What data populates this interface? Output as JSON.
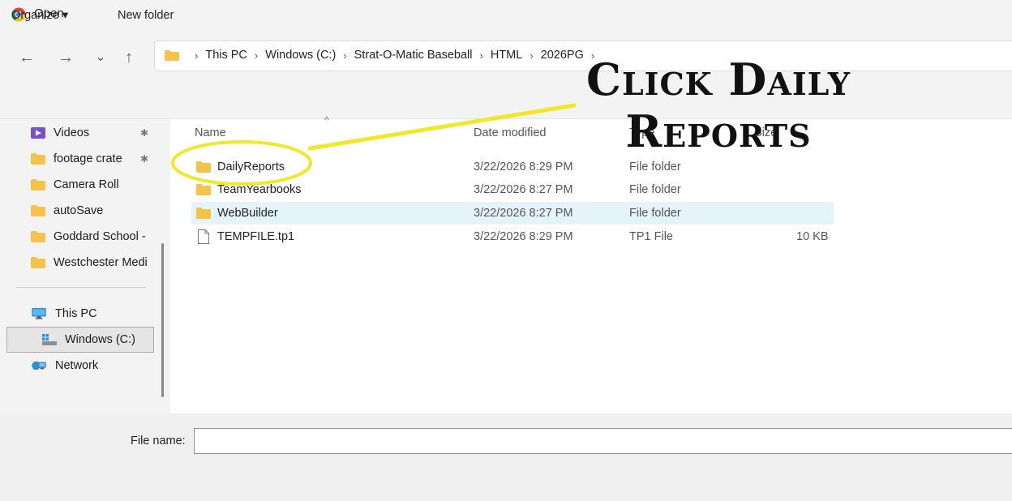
{
  "window": {
    "title": "Open",
    "app_icon": "chrome-icon"
  },
  "nav_buttons": {
    "back": "←",
    "forward": "→",
    "recent": "⌄",
    "up": "↑"
  },
  "breadcrumb": [
    "This PC",
    "Windows (C:)",
    "Strat-O-Matic Baseball",
    "HTML",
    "2026PG"
  ],
  "breadcrumb_separator": "›",
  "toolbar": {
    "organize": "Organize ▾",
    "new_folder": "New folder"
  },
  "sidebar": {
    "quick_access": [
      {
        "label": "Videos",
        "icon": "videos-icon",
        "pinned": true
      },
      {
        "label": "footage crate",
        "icon": "folder-icon",
        "pinned": true
      },
      {
        "label": "Camera Roll",
        "icon": "folder-icon",
        "pinned": false
      },
      {
        "label": "autoSave",
        "icon": "folder-icon",
        "pinned": false
      },
      {
        "label": "Goddard School -",
        "icon": "folder-icon",
        "pinned": false
      },
      {
        "label": "Westchester Medi",
        "icon": "folder-icon",
        "pinned": false
      }
    ],
    "this_pc": "This PC",
    "drive": "Windows (C:)",
    "network": "Network",
    "pin_glyph": "✱"
  },
  "columns": {
    "name": "Name",
    "date": "Date modified",
    "type": "Type",
    "size": "Size"
  },
  "files": [
    {
      "name": "DailyReports",
      "date": "3/22/2026 8:29 PM",
      "type": "File folder",
      "size": "",
      "icon": "folder-icon"
    },
    {
      "name": "TeamYearbooks",
      "date": "3/22/2026 8:27 PM",
      "type": "File folder",
      "size": "",
      "icon": "folder-icon"
    },
    {
      "name": "WebBuilder",
      "date": "3/22/2026 8:27 PM",
      "type": "File folder",
      "size": "",
      "icon": "folder-icon"
    },
    {
      "name": "TEMPFILE.tp1",
      "date": "3/22/2026 8:29 PM",
      "type": "TP1 File",
      "size": "10 KB",
      "icon": "file-icon"
    }
  ],
  "file_name": {
    "label": "File name:",
    "value": ""
  },
  "annotation": {
    "text": "Click Daily\nReports",
    "color": "#f2e82a"
  },
  "colors": {
    "folder": "#f6c34a",
    "highlight": "#e5f3fb",
    "chrome_bg": "#f3f3f3"
  }
}
